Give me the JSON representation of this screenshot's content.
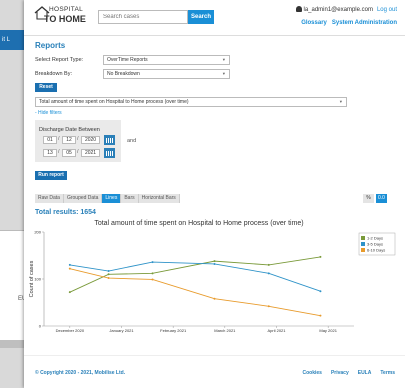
{
  "background_window": {
    "tab_text": "it L",
    "footer_text": "EUL"
  },
  "logo": {
    "line1": "HOSPITAL",
    "line2": "TO HOME"
  },
  "search": {
    "placeholder": "Search cases",
    "button": "Search"
  },
  "user": {
    "email": "la_admin1@example.com",
    "logout": "Log out"
  },
  "nav": [
    "Glossary",
    "System Administration"
  ],
  "page_title": "Reports",
  "form": {
    "report_type_label": "Select Report Type:",
    "report_type_value": "OverTime Reports",
    "breakdown_label": "Breakdown By:",
    "breakdown_value": "No Breakdown",
    "reset": "Reset",
    "metric_value": "Total amount of time spent on Hospital to Home process (over time)",
    "hide_filters": "- Hide filters",
    "discharge_label": "Discharge Date Between",
    "start": {
      "dd": "01",
      "mm": "12",
      "yyyy": "2020"
    },
    "end": {
      "dd": "13",
      "mm": "05",
      "yyyy": "2021"
    },
    "and": "and",
    "run": "Run report"
  },
  "tabs": [
    "Raw Data",
    "Grouped Data",
    "Lines",
    "Bars",
    "Horizontal Bars"
  ],
  "active_tab": "Lines",
  "toggle": {
    "pct": "%",
    "num": "0.0"
  },
  "total": "Total results: 1654",
  "chart_data": {
    "type": "line",
    "title": "Total amount of time spent on Hospital to Home process (over time)",
    "ylabel": "Count of cases",
    "xlabel": "",
    "categories": [
      "December 2020",
      "January 2021",
      "February 2021",
      "March 2021",
      "April 2021",
      "May 2021"
    ],
    "ylim": [
      0,
      200
    ],
    "yticks": [
      0,
      100,
      200
    ],
    "x": [
      0,
      1,
      2,
      3,
      4,
      5
    ],
    "series": [
      {
        "name": "1-2 Days",
        "color": "#7a9a3a",
        "x": [
          0,
          0.75,
          1.6,
          2.8,
          3.85,
          4.85
        ],
        "values": [
          72,
          110,
          112,
          138,
          130,
          147
        ]
      },
      {
        "name": "3-5 Days",
        "color": "#2f93c8",
        "x": [
          0,
          0.75,
          1.6,
          2.8,
          3.85,
          4.85
        ],
        "values": [
          130,
          117,
          136,
          132,
          112,
          74
        ]
      },
      {
        "name": "6-10 Days",
        "color": "#e89b2c",
        "x": [
          0,
          0.75,
          1.6,
          2.8,
          3.85,
          4.85
        ],
        "values": [
          122,
          102,
          99,
          58,
          42,
          22
        ]
      }
    ],
    "legend_position": "top-right",
    "grid": false
  },
  "footer": {
    "copyright": "© Copyright 2020 - 2021, Mobilise Ltd.",
    "links": [
      "Cookies",
      "Privacy",
      "EULA",
      "Terms"
    ]
  }
}
